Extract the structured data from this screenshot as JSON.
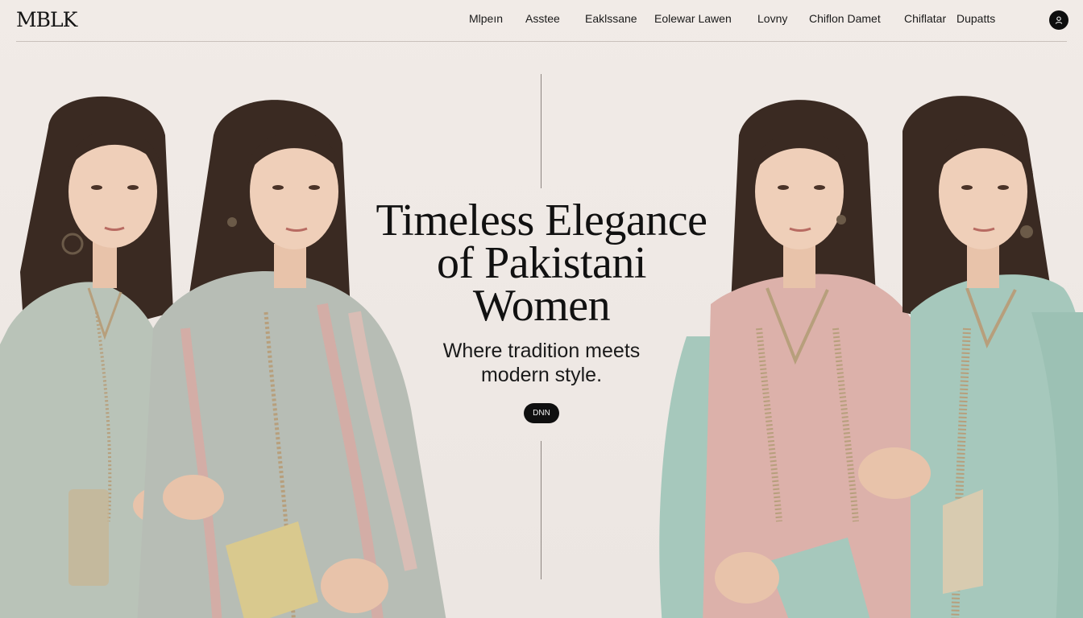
{
  "brand": {
    "logo": "MBLK"
  },
  "nav": {
    "items": [
      {
        "label": "Mlpeın"
      },
      {
        "label": "Asstee"
      },
      {
        "label": "Eaklssane"
      },
      {
        "label": "Eolewar Lawen"
      },
      {
        "label": "Lovny"
      },
      {
        "label": "Chiflon Damet"
      },
      {
        "label": "Chiflatar"
      },
      {
        "label": "Dupatts"
      }
    ]
  },
  "header": {
    "account_icon": "user-icon"
  },
  "hero": {
    "title_line1": "Timeless Elegance",
    "title_line2": "of Pakistani",
    "title_line3": "Women",
    "subtitle_line1": "Where tradition meets",
    "subtitle_line2": "modern style.",
    "cta_label": "DNN"
  },
  "colors": {
    "background": "#efe9e5",
    "text": "#111111",
    "button": "#0f0f0f",
    "outfit_sage": "#b9c3b8",
    "outfit_pastel": "#b7bdb5",
    "outfit_pink": "#dcb1aa",
    "outfit_mint": "#a6c8bc",
    "embroidery": "#b79f7c"
  }
}
